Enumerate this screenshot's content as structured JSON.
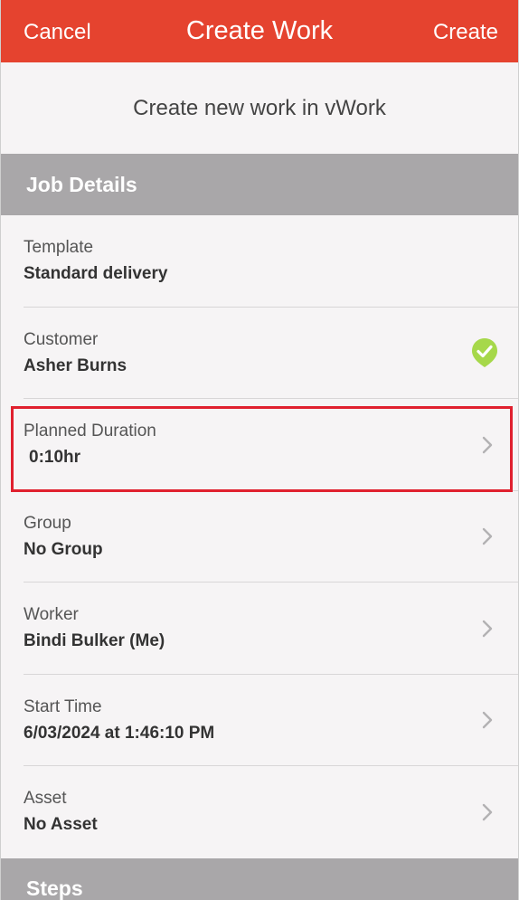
{
  "navbar": {
    "cancel_label": "Cancel",
    "title": "Create Work",
    "create_label": "Create"
  },
  "subtitle": "Create new work in vWork",
  "sections": {
    "job_details": "Job Details",
    "steps": "Steps"
  },
  "fields": {
    "template": {
      "label": "Template",
      "value": "Standard delivery"
    },
    "customer": {
      "label": "Customer",
      "value": "Asher Burns",
      "icon": "verified-check-icon"
    },
    "planned_duration": {
      "label": "Planned Duration",
      "value": "0:10hr",
      "highlighted": true
    },
    "group": {
      "label": "Group",
      "value": "No Group"
    },
    "worker": {
      "label": "Worker",
      "value": "Bindi Bulker (Me)"
    },
    "start_time": {
      "label": "Start Time",
      "value": "6/03/2024 at 1:46:10 PM"
    },
    "asset": {
      "label": "Asset",
      "value": "No Asset"
    }
  },
  "colors": {
    "navbar": "#e5432f",
    "section_header": "#a9a7a9",
    "check": "#a6d84a",
    "highlight": "#e0202e"
  }
}
